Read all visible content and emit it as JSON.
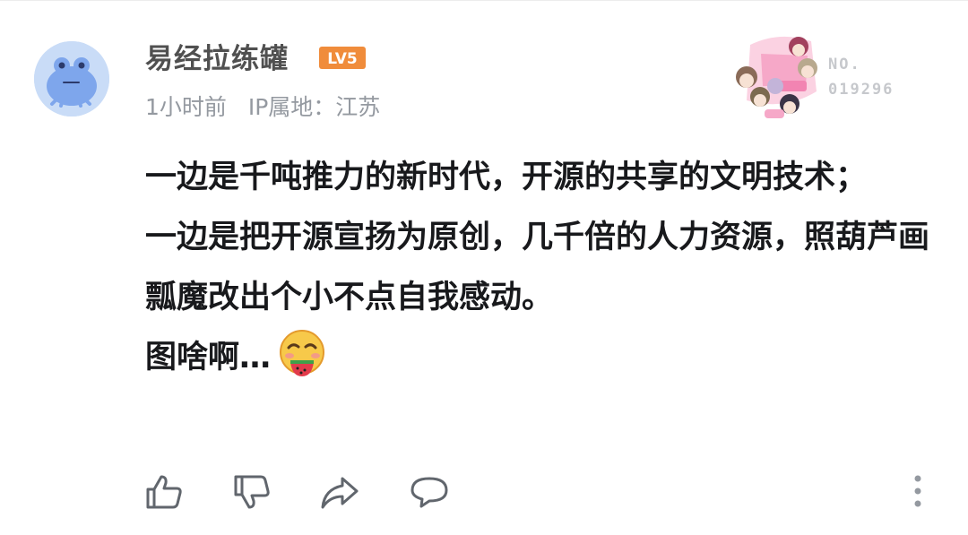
{
  "comment": {
    "username": "易经拉练罐",
    "level": "LV5",
    "time": "1小时前",
    "ip_location": "IP属地：江苏",
    "medal_label": "NO.",
    "medal_number": "019296",
    "content_line1": "一边是千吨推力的新时代，开源的共享的文明技术；",
    "content_line2": "一边是把开源宣扬为原创，几千倍的人力资源，照葫芦画瓢魔改出个小不点自我感动。",
    "content_line3": "图啥啊…"
  },
  "icons": {
    "avatar": "frog-avatar",
    "level_badge": "level-badge-icon",
    "emoji": "eating-watermelon-emoji",
    "like": "thumbs-up-icon",
    "dislike": "thumbs-down-icon",
    "share": "share-icon",
    "reply": "comment-icon",
    "more": "more-vertical-icon"
  },
  "colors": {
    "level_badge": "#f08c3b",
    "username": "#505050",
    "meta": "#9499a0",
    "icon": "#61666d"
  }
}
